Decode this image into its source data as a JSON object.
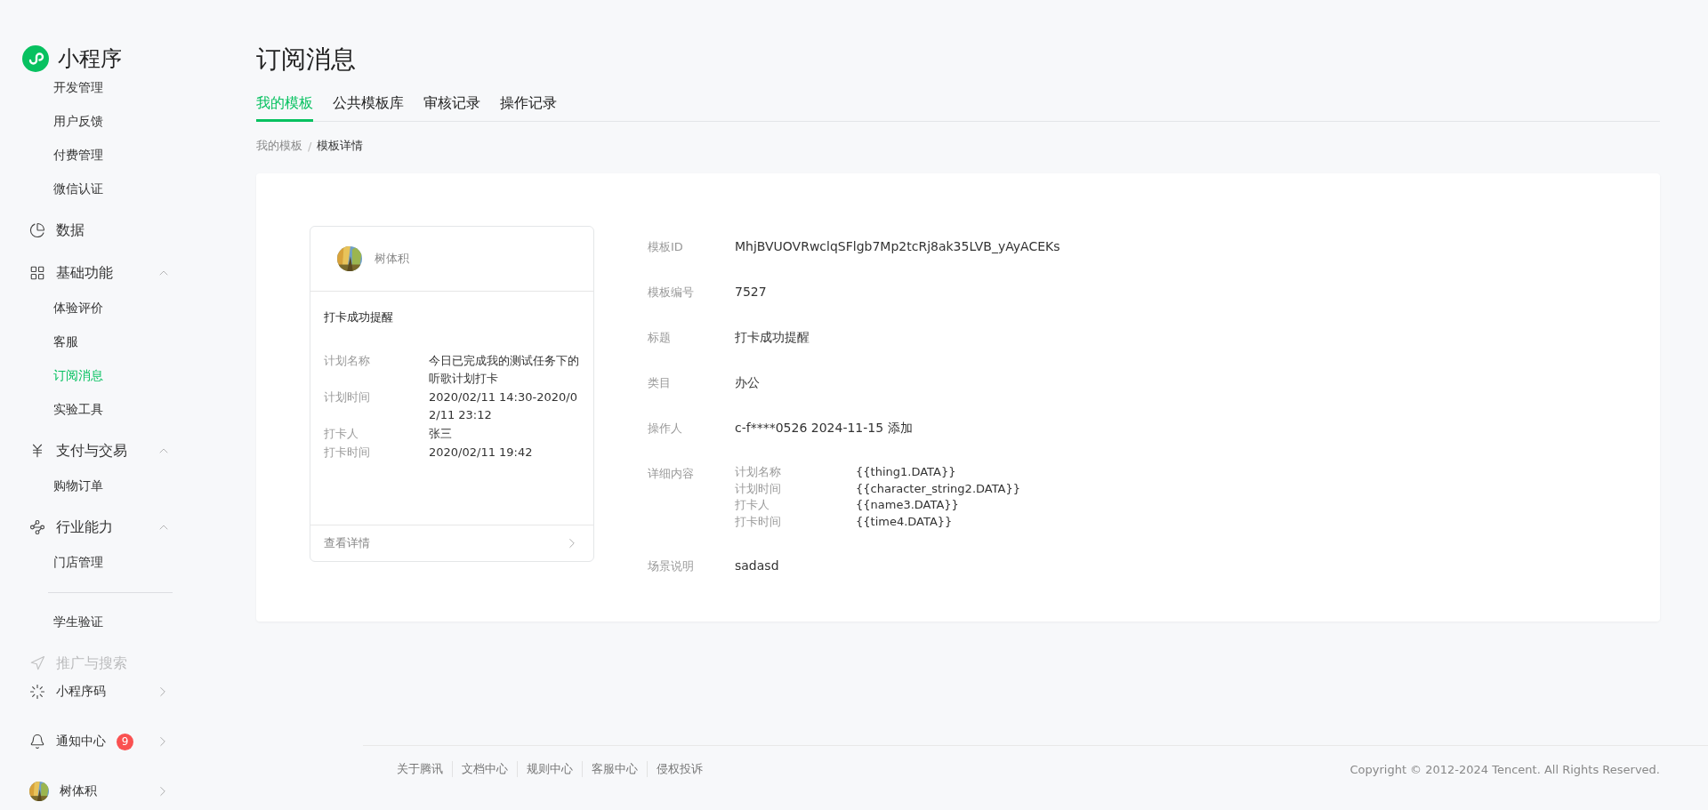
{
  "sidebar": {
    "logo": "小程序",
    "items": [
      {
        "kind": "sub",
        "label": "开发管理",
        "selected": false
      },
      {
        "kind": "sub",
        "label": "用户反馈",
        "selected": false
      },
      {
        "kind": "sub",
        "label": "付费管理",
        "selected": false
      },
      {
        "kind": "sub",
        "label": "微信认证",
        "selected": false
      },
      {
        "kind": "link",
        "label": "数据"
      },
      {
        "kind": "section",
        "label": "基础功能",
        "expanded": true
      },
      {
        "kind": "sub",
        "label": "体验评价",
        "selected": false
      },
      {
        "kind": "sub",
        "label": "客服",
        "selected": false
      },
      {
        "kind": "sub",
        "label": "订阅消息",
        "selected": true
      },
      {
        "kind": "sub",
        "label": "实验工具",
        "selected": false
      },
      {
        "kind": "section",
        "label": "支付与交易",
        "expanded": true
      },
      {
        "kind": "sub",
        "label": "购物订单",
        "selected": false
      },
      {
        "kind": "section",
        "label": "行业能力",
        "expanded": true
      },
      {
        "kind": "sub",
        "label": "门店管理",
        "selected": false
      },
      {
        "kind": "divider"
      },
      {
        "kind": "sub",
        "label": "学生验证",
        "selected": false
      },
      {
        "kind": "section",
        "label": "推广与搜索"
      }
    ],
    "bottom": [
      {
        "kind": "code",
        "label": "小程序码"
      },
      {
        "kind": "bell",
        "label": "通知中心",
        "badge": "9"
      },
      {
        "kind": "account",
        "label": "树体积"
      }
    ]
  },
  "page": {
    "title": "订阅消息",
    "tabs": [
      {
        "label": "我的模板",
        "selected": true
      },
      {
        "label": "公共模板库",
        "selected": false
      },
      {
        "label": "审核记录",
        "selected": false
      },
      {
        "label": "操作记录",
        "selected": false
      }
    ],
    "breadcrumb": {
      "separator": "/",
      "items": [
        {
          "label": "我的模板"
        },
        {
          "label": "模板详情"
        }
      ]
    },
    "preview": {
      "account": "树体积",
      "title": "打卡成功提醒",
      "fields": [
        {
          "label": "计划名称",
          "value": "今日已完成我的测试任务下的听歌计划打卡"
        },
        {
          "label": "计划时间",
          "value": "2020/02/11 14:30-2020/02/11 23:12"
        },
        {
          "label": "打卡人",
          "value": "张三"
        },
        {
          "label": "打卡时间",
          "value": "2020/02/11 19:42"
        }
      ],
      "link": "查看详情"
    },
    "details": [
      {
        "kind": "text",
        "label": "模板ID",
        "value": "MhjBVUOVRwclqSFlgb7Mp2tcRj8ak35LVB_yAyACEKs"
      },
      {
        "kind": "text",
        "label": "模板编号",
        "value": "7527"
      },
      {
        "kind": "text",
        "label": "标题",
        "value": "打卡成功提醒"
      },
      {
        "kind": "text",
        "label": "类目",
        "value": "办公"
      },
      {
        "kind": "text",
        "label": "操作人",
        "value": "c-f****0526 2024-11-15 添加"
      },
      {
        "kind": "fields",
        "label": "详细内容",
        "fields": [
          {
            "name": "计划名称",
            "key": "{{thing1.DATA}}"
          },
          {
            "name": "计划时间",
            "key": "{{character_string2.DATA}}"
          },
          {
            "name": "打卡人",
            "key": "{{name3.DATA}}"
          },
          {
            "name": "打卡时间",
            "key": "{{time4.DATA}}"
          }
        ]
      },
      {
        "kind": "text",
        "label": "场景说明",
        "value": "sadasd"
      }
    ]
  },
  "footer": {
    "links": [
      "关于腾讯",
      "文档中心",
      "规则中心",
      "客服中心",
      "侵权投诉"
    ],
    "copyright": "Copyright © 2012-2024 Tencent. All Rights Reserved."
  }
}
